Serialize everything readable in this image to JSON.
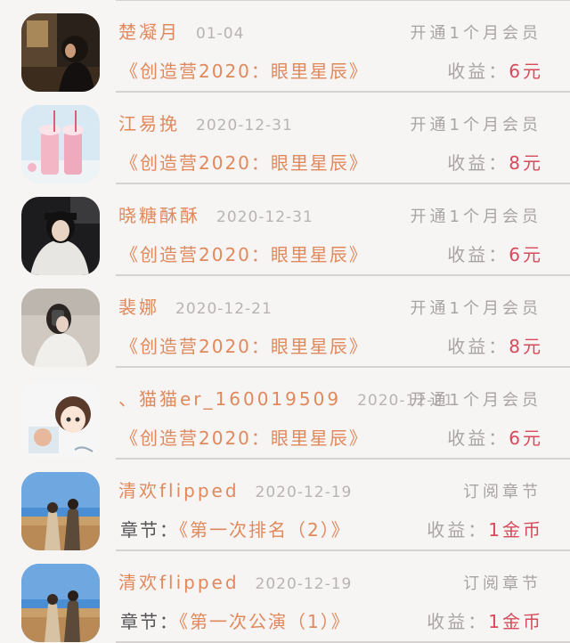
{
  "records": [
    {
      "name": "楚凝月",
      "date": "01-04",
      "action": "开通1个月会员",
      "prefix": "",
      "work": "《创造营2020：眼里星辰》",
      "income_label": "收益：",
      "income_value": "6元",
      "avatar": "night-room"
    },
    {
      "name": "江易挽",
      "date": "2020-12-31",
      "action": "开通1个月会员",
      "prefix": "",
      "work": "《创造营2020：眼里星辰》",
      "income_label": "收益：",
      "income_value": "8元",
      "avatar": "milkshakes"
    },
    {
      "name": "晓糖酥酥",
      "date": "2020-12-31",
      "action": "开通1个月会员",
      "prefix": "",
      "work": "《创造营2020：眼里星辰》",
      "income_label": "收益：",
      "income_value": "6元",
      "avatar": "girl-dark"
    },
    {
      "name": "裴娜",
      "date": "2020-12-21",
      "action": "开通1个月会员",
      "prefix": "",
      "work": "《创造营2020：眼里星辰》",
      "income_label": "收益：",
      "income_value": "8元",
      "avatar": "girl-mirror"
    },
    {
      "name": "、猫猫er_160019509",
      "date": "2020-12-21",
      "action": "开通1个月会员",
      "prefix": "",
      "work": "《创造营2020：眼里星辰》",
      "income_label": "收益：",
      "income_value": "6元",
      "avatar": "cartoon"
    },
    {
      "name": "清欢flipped",
      "date": "2020-12-19",
      "action": "订阅章节",
      "prefix": "章节：",
      "work": "《第一次排名（2）》",
      "income_label": "收益：",
      "income_value": "1金币",
      "avatar": "couple-field"
    },
    {
      "name": "清欢flipped",
      "date": "2020-12-19",
      "action": "订阅章节",
      "prefix": "章节：",
      "work": "《第一次公演（1）》",
      "income_label": "收益：",
      "income_value": "1金币",
      "avatar": "couple-field"
    }
  ]
}
